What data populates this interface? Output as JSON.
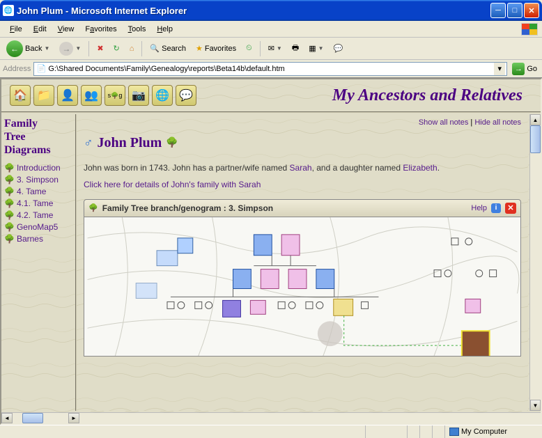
{
  "window": {
    "title": "John Plum - Microsoft Internet Explorer"
  },
  "menu": {
    "file": "File",
    "edit": "Edit",
    "view": "View",
    "favorites": "Favorites",
    "tools": "Tools",
    "help": "Help"
  },
  "toolbar": {
    "back": "Back",
    "search": "Search",
    "favorites": "Favorites"
  },
  "address": {
    "label": "Address",
    "value": "G:\\Shared Documents\\Family\\Genealogy\\reports\\Beta14b\\default.htm",
    "go": "Go"
  },
  "app": {
    "title": "My Ancestors and Relatives"
  },
  "sidebar": {
    "title_line1": "Family",
    "title_line2": "Tree",
    "title_line3": "Diagrams",
    "items": [
      "Introduction",
      "3. Simpson",
      "4. Tame",
      "4.1. Tame",
      "4.2. Tame",
      "GenoMap5",
      "Barnes"
    ]
  },
  "main": {
    "show_all": "Show all notes",
    "hide_all": "Hide all notes",
    "sep": " | ",
    "person_name": "John Plum",
    "bio_part1": "John was born in 1743.  John has a partner/wife named ",
    "bio_link1": "Sarah",
    "bio_part2": ", and a daughter named ",
    "bio_link2": "Elizabeth",
    "bio_part3": ".",
    "family_link": "Click here for details of John's family with Sarah",
    "geno_title": "Family Tree branch/genogram : 3. Simpson",
    "help": "Help"
  },
  "status": {
    "zone": "My Computer"
  }
}
